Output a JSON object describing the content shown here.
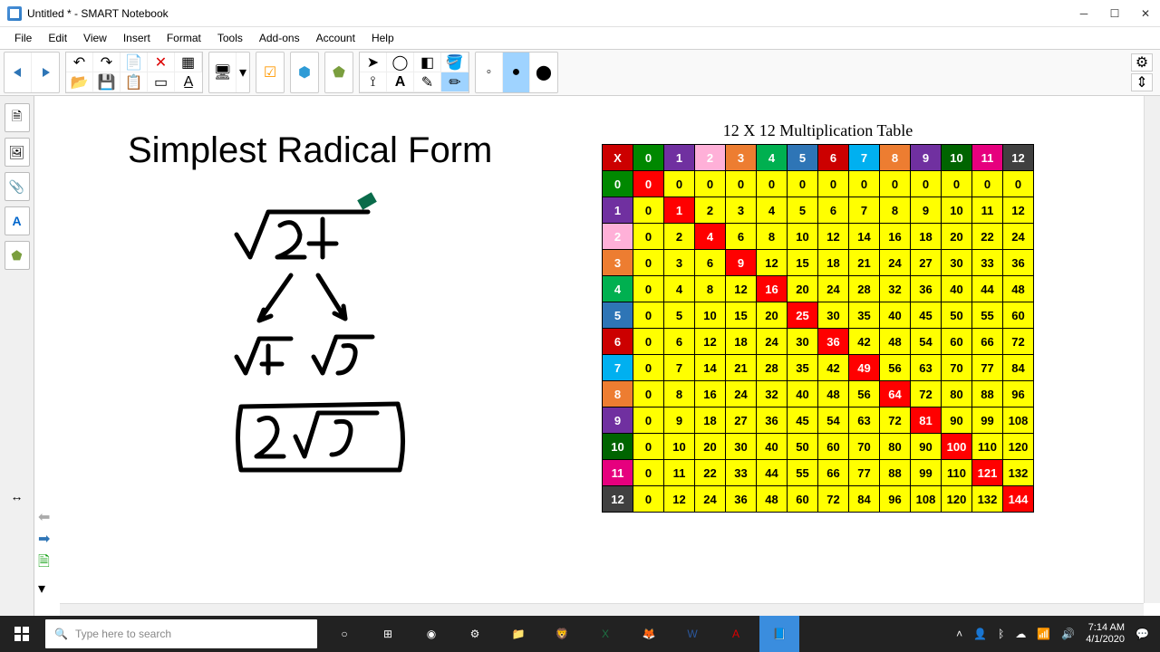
{
  "window": {
    "title": "Untitled * - SMART Notebook"
  },
  "menu": [
    "File",
    "Edit",
    "View",
    "Insert",
    "Format",
    "Tools",
    "Add-ons",
    "Account",
    "Help"
  ],
  "canvas": {
    "heading": "Simplest Radical Form",
    "table_title": "12 X 12 Multiplication Table"
  },
  "search_placeholder": "Type here to search",
  "clock": {
    "time": "7:14 AM",
    "date": "4/1/2020"
  },
  "chart_data": {
    "type": "table",
    "title": "12 X 12 Multiplication Table",
    "row_headers": [
      0,
      1,
      2,
      3,
      4,
      5,
      6,
      7,
      8,
      9,
      10,
      11,
      12
    ],
    "col_headers": [
      0,
      1,
      2,
      3,
      4,
      5,
      6,
      7,
      8,
      9,
      10,
      11,
      12
    ],
    "values": [
      [
        0,
        0,
        0,
        0,
        0,
        0,
        0,
        0,
        0,
        0,
        0,
        0,
        0
      ],
      [
        0,
        1,
        2,
        3,
        4,
        5,
        6,
        7,
        8,
        9,
        10,
        11,
        12
      ],
      [
        0,
        2,
        4,
        6,
        8,
        10,
        12,
        14,
        16,
        18,
        20,
        22,
        24
      ],
      [
        0,
        3,
        6,
        9,
        12,
        15,
        18,
        21,
        24,
        27,
        30,
        33,
        36
      ],
      [
        0,
        4,
        8,
        12,
        16,
        20,
        24,
        28,
        32,
        36,
        40,
        44,
        48
      ],
      [
        0,
        5,
        10,
        15,
        20,
        25,
        30,
        35,
        40,
        45,
        50,
        55,
        60
      ],
      [
        0,
        6,
        12,
        18,
        24,
        30,
        36,
        42,
        48,
        54,
        60,
        66,
        72
      ],
      [
        0,
        7,
        14,
        21,
        28,
        35,
        42,
        49,
        56,
        63,
        70,
        77,
        84
      ],
      [
        0,
        8,
        16,
        24,
        32,
        40,
        48,
        56,
        64,
        72,
        80,
        88,
        96
      ],
      [
        0,
        9,
        18,
        27,
        36,
        45,
        54,
        63,
        72,
        81,
        90,
        99,
        108
      ],
      [
        0,
        10,
        20,
        30,
        40,
        50,
        60,
        70,
        80,
        90,
        100,
        110,
        120
      ],
      [
        0,
        11,
        22,
        33,
        44,
        55,
        66,
        77,
        88,
        99,
        110,
        121,
        132
      ],
      [
        0,
        12,
        24,
        36,
        48,
        60,
        72,
        84,
        96,
        108,
        120,
        132,
        144
      ]
    ]
  },
  "handwritten_math": {
    "problem": "√24",
    "factors": [
      "√4",
      "√6"
    ],
    "answer": "2√6"
  }
}
